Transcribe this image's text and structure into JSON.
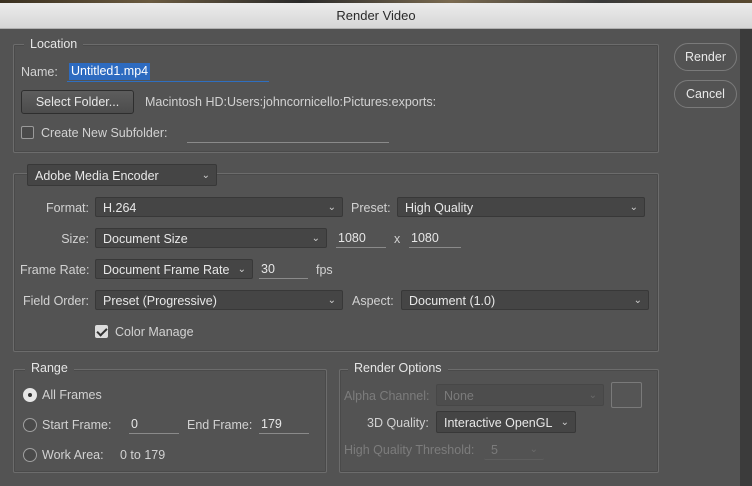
{
  "window": {
    "title": "Render Video"
  },
  "buttons": {
    "render": "Render",
    "cancel": "Cancel"
  },
  "location": {
    "legend": "Location",
    "name_label": "Name:",
    "name_value": "Untitled1.mp4",
    "select_folder": "Select Folder...",
    "folder_path": "Macintosh HD:Users:johncornicello:Pictures:exports:",
    "subfolder_label": "Create New Subfolder:",
    "subfolder_checked": false,
    "subfolder_value": ""
  },
  "encoder": {
    "selected": "Adobe Media Encoder",
    "format_label": "Format:",
    "format_value": "H.264",
    "preset_label": "Preset:",
    "preset_value": "High Quality",
    "size_label": "Size:",
    "size_value": "Document Size",
    "width": "1080",
    "x_sep": "x",
    "height": "1080",
    "framerate_label": "Frame Rate:",
    "framerate_value": "Document Frame Rate",
    "fps_value": "30",
    "fps_unit": "fps",
    "fieldorder_label": "Field Order:",
    "fieldorder_value": "Preset (Progressive)",
    "aspect_label": "Aspect:",
    "aspect_value": "Document (1.0)",
    "color_manage_label": "Color Manage",
    "color_manage_checked": true
  },
  "range": {
    "legend": "Range",
    "all_frames": "All Frames",
    "start_frame_label": "Start Frame:",
    "start_frame_value": "0",
    "end_frame_label": "End Frame:",
    "end_frame_value": "179",
    "work_area_label": "Work Area:",
    "work_area_value": "0 to 179",
    "selected": "all_frames"
  },
  "render_options": {
    "legend": "Render Options",
    "alpha_label": "Alpha Channel:",
    "alpha_value": "None",
    "quality_label": "3D Quality:",
    "quality_value": "Interactive OpenGL",
    "threshold_label": "High Quality Threshold:",
    "threshold_value": "5"
  },
  "icons": {
    "chevron": "chevron-down-icon",
    "checkmark": "checkmark-icon"
  }
}
